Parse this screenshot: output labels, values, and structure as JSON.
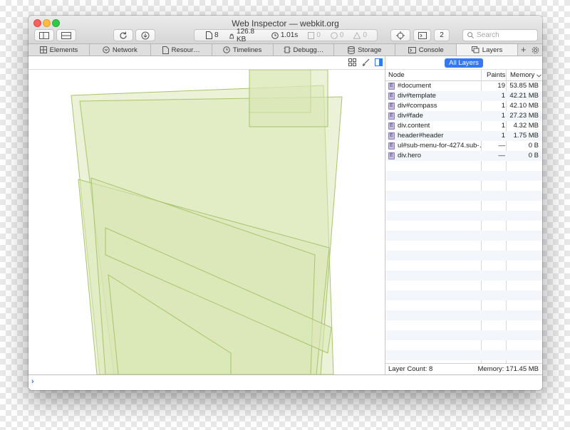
{
  "window": {
    "title": "Web Inspector — webkit.org"
  },
  "toolbar": {
    "activity": {
      "resources": "8",
      "size": "126.8 KB",
      "time": "1.01s",
      "logs": "0",
      "errors": "0",
      "warnings": "0"
    },
    "badge_count": "2",
    "search_placeholder": "Search"
  },
  "tabs": [
    {
      "label": "Elements",
      "icon": "elements-icon"
    },
    {
      "label": "Network",
      "icon": "network-icon"
    },
    {
      "label": "Resour…",
      "icon": "resources-icon"
    },
    {
      "label": "Timelines",
      "icon": "timelines-icon"
    },
    {
      "label": "Debugg…",
      "icon": "debugger-icon"
    },
    {
      "label": "Storage",
      "icon": "storage-icon"
    },
    {
      "label": "Console",
      "icon": "console-icon"
    },
    {
      "label": "Layers",
      "icon": "layers-icon"
    }
  ],
  "sidebar": {
    "scope": "All Layers",
    "columns": {
      "node": "Node",
      "paints": "Paints",
      "memory": "Memory"
    },
    "layers": [
      {
        "node": "#document",
        "paints": "19",
        "memory": "53.85 MB"
      },
      {
        "node": "div#template",
        "paints": "1",
        "memory": "42.21 MB"
      },
      {
        "node": "div#compass",
        "paints": "1",
        "memory": "42.10 MB"
      },
      {
        "node": "div#fade",
        "paints": "1",
        "memory": "27.23 MB"
      },
      {
        "node": "div.content",
        "paints": "1",
        "memory": "4.32 MB"
      },
      {
        "node": "header#header",
        "paints": "1",
        "memory": "1.75 MB"
      },
      {
        "node": "ul#sub-menu-for-4274.sub-…",
        "paints": "—",
        "memory": "0 B"
      },
      {
        "node": "div.hero",
        "paints": "—",
        "memory": "0 B"
      }
    ],
    "footer": {
      "count": "Layer Count: 8",
      "memory": "Memory: 171.45 MB"
    }
  },
  "colors": {
    "layer_fill": "#dbe8b6",
    "layer_stroke": "#a9c46d",
    "accent": "#3478f6",
    "node_icon": "#c7bde0"
  },
  "console": {
    "prompt": "›"
  }
}
